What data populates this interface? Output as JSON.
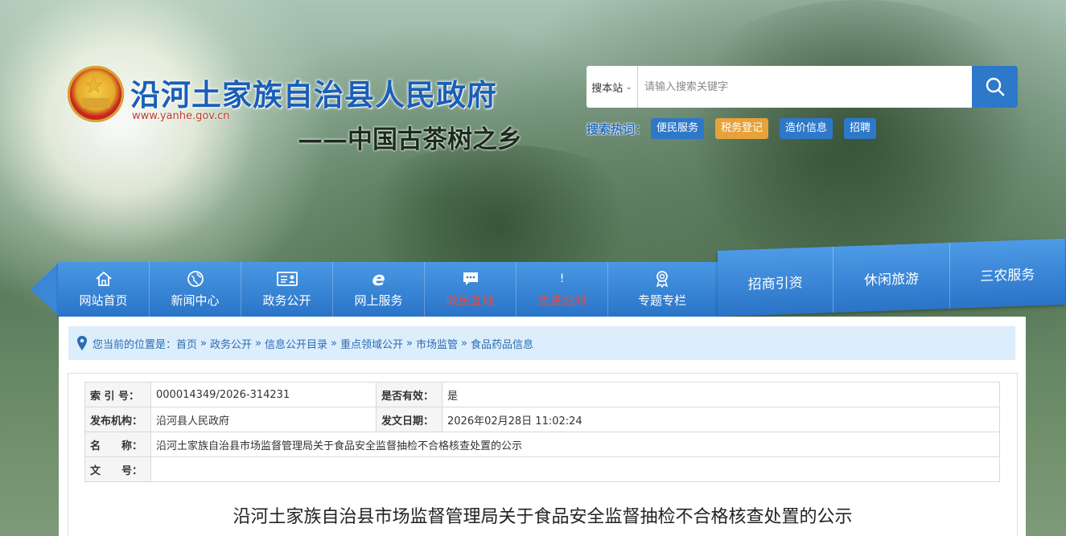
{
  "header": {
    "site_title": "沿河土家族自治县人民政府",
    "site_url": "www.yanhe.gov.cn",
    "slogan": "——中国古茶树之乡"
  },
  "search": {
    "scope": "搜本站",
    "placeholder": "请输入搜索关键字",
    "hot_label": "搜索热词：",
    "hot_tags": [
      {
        "label": "便民服务",
        "color": "#2e78c9"
      },
      {
        "label": "税务登记",
        "color": "#e6a23c"
      },
      {
        "label": "造价信息",
        "color": "#2e78c9"
      },
      {
        "label": "招聘",
        "color": "#2e78c9"
      }
    ]
  },
  "nav": {
    "items": [
      {
        "label": "网站首页",
        "icon": "home-icon"
      },
      {
        "label": "新闻中心",
        "icon": "globe-icon"
      },
      {
        "label": "政务公开",
        "icon": "id-card-icon"
      },
      {
        "label": "网上服务",
        "icon": "ie-icon"
      },
      {
        "label": "政民互动",
        "icon": "chat-icon",
        "highlight": "#e74c3c"
      },
      {
        "label": "走进沿河",
        "icon": "info-icon"
      },
      {
        "label": "专题专栏",
        "icon": "award-icon"
      }
    ],
    "ribbon": [
      "招商引资",
      "休闲旅游",
      "三农服务"
    ]
  },
  "breadcrumb": {
    "prefix": "您当前的位置是：",
    "items": [
      "首页",
      "政务公开",
      "信息公开目录",
      "重点领域公开",
      "市场监管",
      "食品药品信息"
    ],
    "separator": "»"
  },
  "meta": {
    "index_label": "索 引 号：",
    "index_value": "000014349/2026-314231",
    "valid_label": "是否有效：",
    "valid_value": "是",
    "org_label": "发布机构：",
    "org_value": "沿河县人民政府",
    "date_label": "发文日期：",
    "date_value": "2026年02月28日 11:02:24",
    "name_label": "名　　称：",
    "name_value": "沿河土家族自治县市场监督管理局关于食品安全监督抽检不合格核查处置的公示",
    "docno_label": "文　　号：",
    "docno_value": ""
  },
  "doc": {
    "title": "沿河土家族自治县市场监督管理局关于食品安全监督抽检不合格核查处置的公示"
  }
}
